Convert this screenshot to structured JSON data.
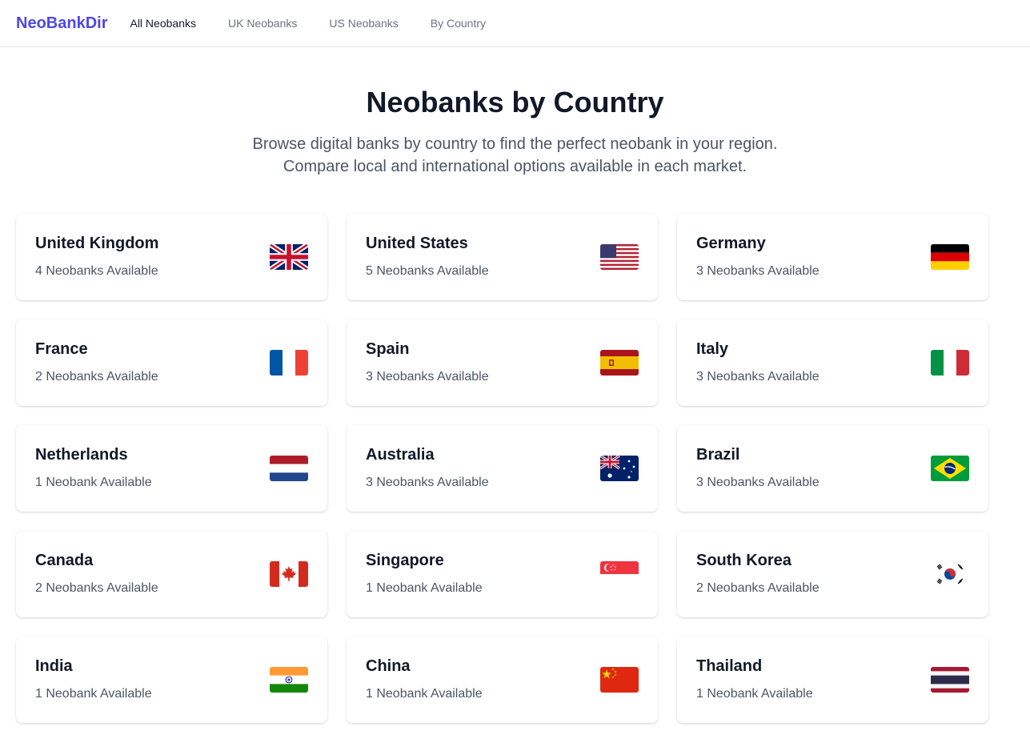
{
  "nav": {
    "brand": "NeoBankDir",
    "links": [
      "All Neobanks",
      "UK Neobanks",
      "US Neobanks",
      "By Country"
    ]
  },
  "hero": {
    "title": "Neobanks by Country",
    "subtitle_line1": "Browse digital banks by country to find the perfect neobank in your region.",
    "subtitle_line2": "Compare local and international options available in each market."
  },
  "countries": [
    {
      "name": "United Kingdom",
      "count": "4 Neobanks Available",
      "flag": "uk-flag-icon"
    },
    {
      "name": "United States",
      "count": "5 Neobanks Available",
      "flag": "us-flag-icon"
    },
    {
      "name": "Germany",
      "count": "3 Neobanks Available",
      "flag": "germany-flag-icon"
    },
    {
      "name": "France",
      "count": "2 Neobanks Available",
      "flag": "france-flag-icon"
    },
    {
      "name": "Spain",
      "count": "3 Neobanks Available",
      "flag": "spain-flag-icon"
    },
    {
      "name": "Italy",
      "count": "3 Neobanks Available",
      "flag": "italy-flag-icon"
    },
    {
      "name": "Netherlands",
      "count": "1 Neobank Available",
      "flag": "netherlands-flag-icon"
    },
    {
      "name": "Australia",
      "count": "3 Neobanks Available",
      "flag": "australia-flag-icon"
    },
    {
      "name": "Brazil",
      "count": "3 Neobanks Available",
      "flag": "brazil-flag-icon"
    },
    {
      "name": "Canada",
      "count": "2 Neobanks Available",
      "flag": "canada-flag-icon"
    },
    {
      "name": "Singapore",
      "count": "1 Neobank Available",
      "flag": "singapore-flag-icon"
    },
    {
      "name": "South Korea",
      "count": "2 Neobanks Available",
      "flag": "south-korea-flag-icon"
    },
    {
      "name": "India",
      "count": "1 Neobank Available",
      "flag": "india-flag-icon"
    },
    {
      "name": "China",
      "count": "1 Neobank Available",
      "flag": "china-flag-icon"
    },
    {
      "name": "Thailand",
      "count": "1 Neobank Available",
      "flag": "thailand-flag-icon"
    }
  ],
  "colors": {
    "brand": "#4f46e5",
    "heading": "#111827",
    "muted": "#4b5563"
  }
}
